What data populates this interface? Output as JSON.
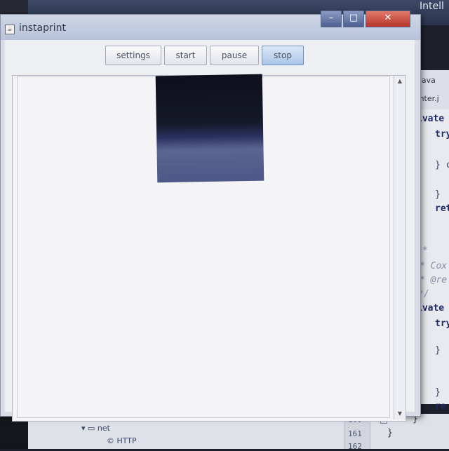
{
  "window": {
    "title": "instaprint"
  },
  "toolbar": {
    "settings_label": "settings",
    "start_label": "start",
    "pause_label": "pause",
    "stop_label": "stop"
  },
  "window_controls": {
    "minimize": "–",
    "maximize": "□",
    "close": "✕"
  },
  "ide": {
    "title": "Intell",
    "tabs": [
      "t.java",
      "rinter.j"
    ],
    "code_lines": [
      "ivate",
      "try",
      "} c",
      "}",
      "ret",
      "**",
      "* Cox",
      "* @re",
      "*/",
      "ivate",
      "try",
      "}",
      "}",
      "re"
    ],
    "tree": {
      "folder": "net",
      "file": "HTTP"
    },
    "line_numbers": [
      "160",
      "161",
      "162"
    ]
  }
}
